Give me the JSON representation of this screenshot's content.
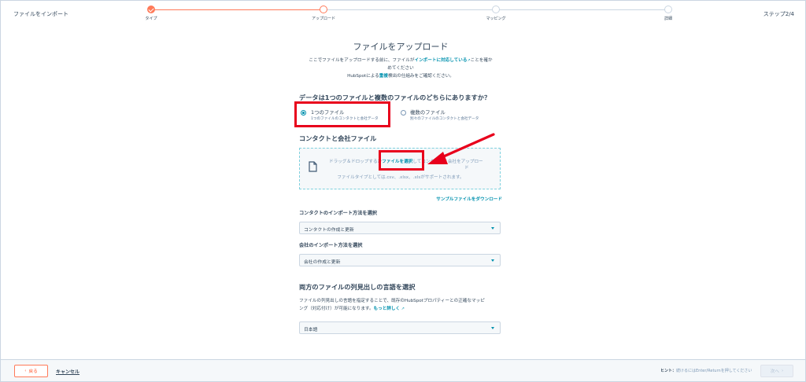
{
  "app": {
    "title": "ファイルをインポート",
    "step_counter": "ステップ2/4"
  },
  "stepper": {
    "steps": [
      {
        "label": "タイプ",
        "state": "done"
      },
      {
        "label": "アップロード",
        "state": "current"
      },
      {
        "label": "マッピング",
        "state": "upcoming"
      },
      {
        "label": "詳細",
        "state": "upcoming"
      }
    ]
  },
  "upload": {
    "title": "ファイルをアップロード",
    "intro_a": "ここでファイルをアップロードする前に、ファイルが",
    "intro_link": "インポートに対応している",
    "intro_b": "ことを確か",
    "intro_c": "めてください",
    "intro_d": "HubSpotによる",
    "intro_link2": "重複",
    "intro_e": "検出の仕組みをご確認ください。"
  },
  "question": {
    "title": "データは1つのファイルと複数のファイルのどちらにありますか？",
    "options": [
      {
        "label": "1つのファイル",
        "desc": "1つのファイルのコンタクトと会社データ",
        "selected": true
      },
      {
        "label": "複数のファイル",
        "desc": "別々のファイルのコンタクトと会社データ",
        "selected": false
      }
    ]
  },
  "files_section": {
    "title": "コンタクトと会社ファイル",
    "drop_a": "ドラッグ＆ドロップするか",
    "drop_link": "ファイルを選択",
    "drop_b": "してコンタクトと会社をアップロー",
    "drop_c": "ド",
    "types_hint": "ファイルタイプとしては.csv、.xlsx、.xlsがサポートされます。",
    "sample_link": "サンプルファイルをダウンロード"
  },
  "contact_method": {
    "label": "コンタクトのインポート方法を選択",
    "value": "コンタクトの作成と更新"
  },
  "company_method": {
    "label": "会社のインポート方法を選択",
    "value": "会社の作成と更新"
  },
  "language": {
    "title": "両方のファイルの列見出しの言語を選択",
    "desc_a": "ファイルの列見出しの言語を指定することで、既存のHubSpotプロパティーとの正確なマッピ",
    "desc_b": "ング（対応付け）が可能になります。",
    "more_link": "もっと詳しく",
    "value": "日本語"
  },
  "footer": {
    "back": "戻る",
    "back_icon": "‹",
    "cancel": "キャンセル",
    "hint_label": "ヒント：",
    "hint_text": "続けるにはEnter/Returnを押してください",
    "next": "次へ",
    "next_icon": "›"
  },
  "colors": {
    "accent": "#ff7a59",
    "link": "#0091ae",
    "annotation": "#e8001c"
  }
}
